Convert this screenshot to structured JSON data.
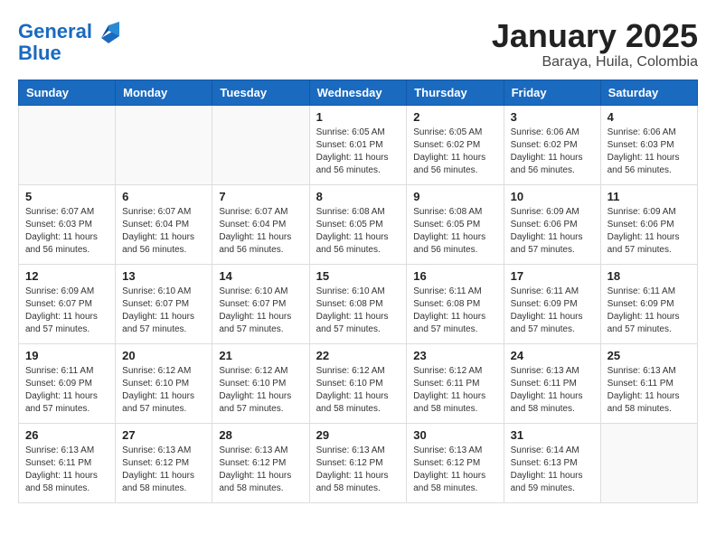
{
  "header": {
    "logo_line1": "General",
    "logo_line2": "Blue",
    "month_title": "January 2025",
    "location": "Baraya, Huila, Colombia"
  },
  "weekdays": [
    "Sunday",
    "Monday",
    "Tuesday",
    "Wednesday",
    "Thursday",
    "Friday",
    "Saturday"
  ],
  "weeks": [
    [
      {
        "day": "",
        "info": ""
      },
      {
        "day": "",
        "info": ""
      },
      {
        "day": "",
        "info": ""
      },
      {
        "day": "1",
        "info": "Sunrise: 6:05 AM\nSunset: 6:01 PM\nDaylight: 11 hours and 56 minutes."
      },
      {
        "day": "2",
        "info": "Sunrise: 6:05 AM\nSunset: 6:02 PM\nDaylight: 11 hours and 56 minutes."
      },
      {
        "day": "3",
        "info": "Sunrise: 6:06 AM\nSunset: 6:02 PM\nDaylight: 11 hours and 56 minutes."
      },
      {
        "day": "4",
        "info": "Sunrise: 6:06 AM\nSunset: 6:03 PM\nDaylight: 11 hours and 56 minutes."
      }
    ],
    [
      {
        "day": "5",
        "info": "Sunrise: 6:07 AM\nSunset: 6:03 PM\nDaylight: 11 hours and 56 minutes."
      },
      {
        "day": "6",
        "info": "Sunrise: 6:07 AM\nSunset: 6:04 PM\nDaylight: 11 hours and 56 minutes."
      },
      {
        "day": "7",
        "info": "Sunrise: 6:07 AM\nSunset: 6:04 PM\nDaylight: 11 hours and 56 minutes."
      },
      {
        "day": "8",
        "info": "Sunrise: 6:08 AM\nSunset: 6:05 PM\nDaylight: 11 hours and 56 minutes."
      },
      {
        "day": "9",
        "info": "Sunrise: 6:08 AM\nSunset: 6:05 PM\nDaylight: 11 hours and 56 minutes."
      },
      {
        "day": "10",
        "info": "Sunrise: 6:09 AM\nSunset: 6:06 PM\nDaylight: 11 hours and 57 minutes."
      },
      {
        "day": "11",
        "info": "Sunrise: 6:09 AM\nSunset: 6:06 PM\nDaylight: 11 hours and 57 minutes."
      }
    ],
    [
      {
        "day": "12",
        "info": "Sunrise: 6:09 AM\nSunset: 6:07 PM\nDaylight: 11 hours and 57 minutes."
      },
      {
        "day": "13",
        "info": "Sunrise: 6:10 AM\nSunset: 6:07 PM\nDaylight: 11 hours and 57 minutes."
      },
      {
        "day": "14",
        "info": "Sunrise: 6:10 AM\nSunset: 6:07 PM\nDaylight: 11 hours and 57 minutes."
      },
      {
        "day": "15",
        "info": "Sunrise: 6:10 AM\nSunset: 6:08 PM\nDaylight: 11 hours and 57 minutes."
      },
      {
        "day": "16",
        "info": "Sunrise: 6:11 AM\nSunset: 6:08 PM\nDaylight: 11 hours and 57 minutes."
      },
      {
        "day": "17",
        "info": "Sunrise: 6:11 AM\nSunset: 6:09 PM\nDaylight: 11 hours and 57 minutes."
      },
      {
        "day": "18",
        "info": "Sunrise: 6:11 AM\nSunset: 6:09 PM\nDaylight: 11 hours and 57 minutes."
      }
    ],
    [
      {
        "day": "19",
        "info": "Sunrise: 6:11 AM\nSunset: 6:09 PM\nDaylight: 11 hours and 57 minutes."
      },
      {
        "day": "20",
        "info": "Sunrise: 6:12 AM\nSunset: 6:10 PM\nDaylight: 11 hours and 57 minutes."
      },
      {
        "day": "21",
        "info": "Sunrise: 6:12 AM\nSunset: 6:10 PM\nDaylight: 11 hours and 57 minutes."
      },
      {
        "day": "22",
        "info": "Sunrise: 6:12 AM\nSunset: 6:10 PM\nDaylight: 11 hours and 58 minutes."
      },
      {
        "day": "23",
        "info": "Sunrise: 6:12 AM\nSunset: 6:11 PM\nDaylight: 11 hours and 58 minutes."
      },
      {
        "day": "24",
        "info": "Sunrise: 6:13 AM\nSunset: 6:11 PM\nDaylight: 11 hours and 58 minutes."
      },
      {
        "day": "25",
        "info": "Sunrise: 6:13 AM\nSunset: 6:11 PM\nDaylight: 11 hours and 58 minutes."
      }
    ],
    [
      {
        "day": "26",
        "info": "Sunrise: 6:13 AM\nSunset: 6:11 PM\nDaylight: 11 hours and 58 minutes."
      },
      {
        "day": "27",
        "info": "Sunrise: 6:13 AM\nSunset: 6:12 PM\nDaylight: 11 hours and 58 minutes."
      },
      {
        "day": "28",
        "info": "Sunrise: 6:13 AM\nSunset: 6:12 PM\nDaylight: 11 hours and 58 minutes."
      },
      {
        "day": "29",
        "info": "Sunrise: 6:13 AM\nSunset: 6:12 PM\nDaylight: 11 hours and 58 minutes."
      },
      {
        "day": "30",
        "info": "Sunrise: 6:13 AM\nSunset: 6:12 PM\nDaylight: 11 hours and 58 minutes."
      },
      {
        "day": "31",
        "info": "Sunrise: 6:14 AM\nSunset: 6:13 PM\nDaylight: 11 hours and 59 minutes."
      },
      {
        "day": "",
        "info": ""
      }
    ]
  ]
}
